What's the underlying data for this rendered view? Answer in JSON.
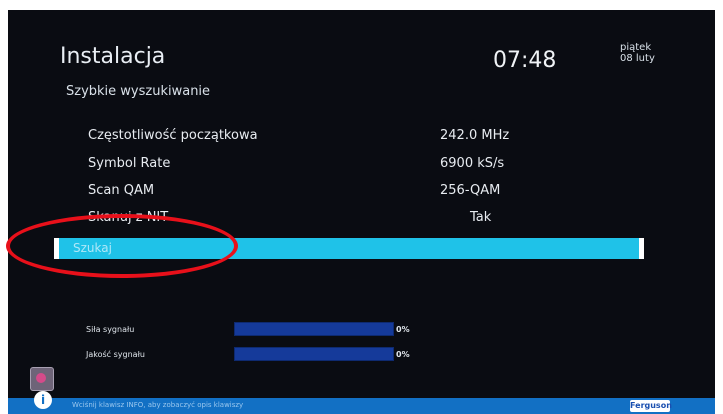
{
  "header": {
    "title": "Instalacja",
    "subtitle": "Szybkie wyszukiwanie",
    "time": "07:48",
    "day": "piątek",
    "date": "08 luty"
  },
  "settings": [
    {
      "label": "Częstotliwość początkowa",
      "value": "242.0 MHz"
    },
    {
      "label": "Symbol Rate",
      "value": "6900 kS/s"
    },
    {
      "label": "Scan QAM",
      "value": "256-QAM"
    },
    {
      "label": "Skanuj z NIT",
      "value": "Tak"
    }
  ],
  "search_button": {
    "label": "Szukaj"
  },
  "signal": {
    "strength_label": "Siła sygnału",
    "strength_value": "0%",
    "quality_label": "Jakość sygnału",
    "quality_value": "0%"
  },
  "footer": {
    "hint": "Wciśnij klawisz INFO, aby zobaczyć opis klawiszy",
    "info_glyph": "i",
    "logo": "Ferguson"
  },
  "colors": {
    "highlight": "#1fc2e8",
    "annotation": "#e8101a",
    "footer": "#1270c4"
  }
}
